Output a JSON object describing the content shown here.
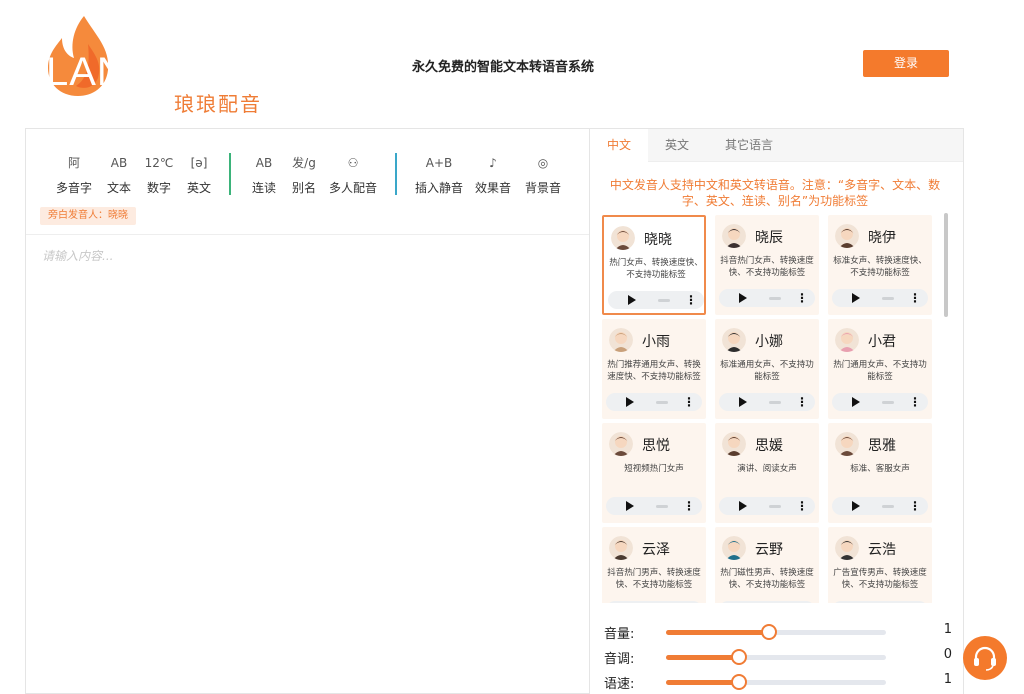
{
  "brand": {
    "logo_text": "LANGLANG",
    "logo_sub": "琅琅配音",
    "slogan": "永久免费的智能文本转语音系统",
    "accent": "#f47a2c"
  },
  "header": {
    "login_label": "登录"
  },
  "toolbar": {
    "groups": [
      [
        {
          "icon": "polyphone-icon",
          "glyph": "阿",
          "label": "多音字"
        },
        {
          "icon": "text-icon",
          "glyph": "AB",
          "label": "文本"
        },
        {
          "icon": "number-icon",
          "glyph": "12℃",
          "label": "数字"
        },
        {
          "icon": "english-icon",
          "glyph": "[ə]",
          "label": "英文"
        }
      ],
      [
        {
          "icon": "liaison-icon",
          "glyph": "AB",
          "label": "连读"
        },
        {
          "icon": "alias-icon",
          "glyph": "发/g",
          "label": "别名"
        },
        {
          "icon": "multi-speaker-icon",
          "glyph": "⚇",
          "label": "多人配音"
        }
      ],
      [
        {
          "icon": "insert-silence-icon",
          "glyph": "A+B",
          "label": "插入静音"
        },
        {
          "icon": "sound-effect-icon",
          "glyph": "♪",
          "label": "效果音"
        },
        {
          "icon": "background-music-icon",
          "glyph": "◎",
          "label": "背景音"
        }
      ]
    ],
    "narrator_tag": "旁白发音人：晓晓"
  },
  "editor": {
    "placeholder": "请输入内容..."
  },
  "panel": {
    "tabs": [
      "中文",
      "英文",
      "其它语言"
    ],
    "active_tab": 0,
    "notice": "中文发音人支持中文和英文转语音。注意：“多音字、文本、数字、英文、连读、别名”为功能标签",
    "voices": [
      {
        "name": "晓晓",
        "desc": "热门女声、转换速度快、不支持功能标签",
        "selected": true,
        "avatar": "female-avatar"
      },
      {
        "name": "晓辰",
        "desc": "抖音热门女声、转换速度快、不支持功能标签",
        "selected": false,
        "avatar": "female-avatar"
      },
      {
        "name": "晓伊",
        "desc": "标准女声、转换速度快、不支持功能标签",
        "selected": false,
        "avatar": "female-avatar"
      },
      {
        "name": "小雨",
        "desc": "热门推荐通用女声、转换速度快、不支持功能标签",
        "selected": false,
        "avatar": "female-avatar"
      },
      {
        "name": "小娜",
        "desc": "标准通用女声、不支持功能标签",
        "selected": false,
        "avatar": "female-avatar"
      },
      {
        "name": "小君",
        "desc": "热门通用女声、不支持功能标签",
        "selected": false,
        "avatar": "female-avatar"
      },
      {
        "name": "思悦",
        "desc": "短视频热门女声",
        "selected": false,
        "avatar": "female-avatar"
      },
      {
        "name": "思媛",
        "desc": "演讲、阅读女声",
        "selected": false,
        "avatar": "female-avatar"
      },
      {
        "name": "思雅",
        "desc": "标准、客服女声",
        "selected": false,
        "avatar": "female-avatar"
      },
      {
        "name": "云泽",
        "desc": "抖音热门男声、转换速度快、不支持功能标签",
        "selected": false,
        "avatar": "male-avatar"
      },
      {
        "name": "云野",
        "desc": "热门磁性男声、转换速度快、不支持功能标签",
        "selected": false,
        "avatar": "male-avatar"
      },
      {
        "name": "云浩",
        "desc": "广告宣传男声、转换速度快、不支持功能标签",
        "selected": false,
        "avatar": "male-avatar"
      }
    ],
    "sliders": [
      {
        "label": "音量:",
        "value": "1",
        "fraction": 0.47
      },
      {
        "label": "音调:",
        "value": "0",
        "fraction": 0.33
      },
      {
        "label": "语速:",
        "value": "1",
        "fraction": 0.33
      }
    ]
  }
}
